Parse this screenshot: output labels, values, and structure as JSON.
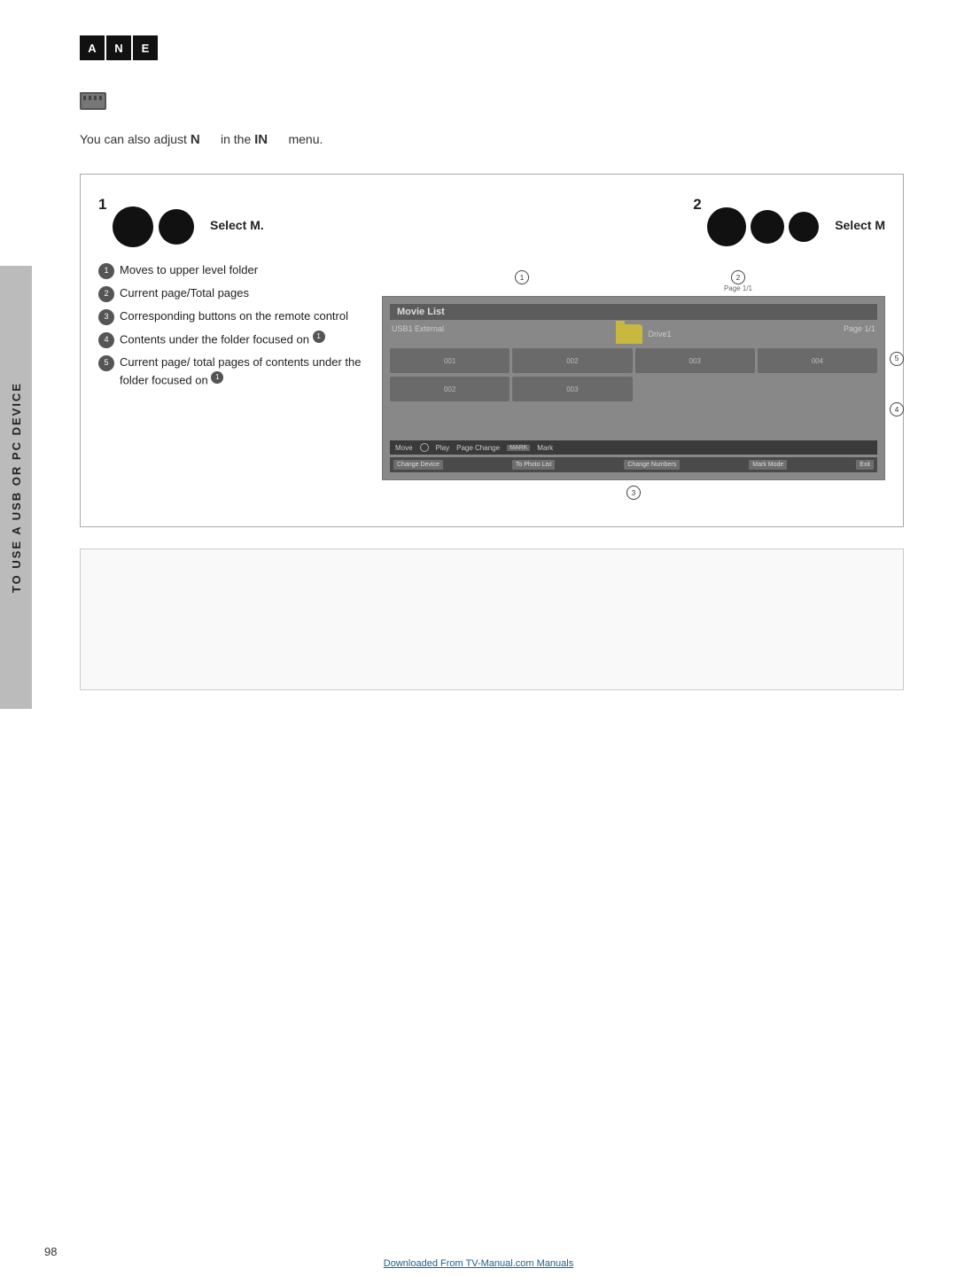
{
  "logo": {
    "blocks": [
      "A",
      "N",
      "E"
    ]
  },
  "sidebar": {
    "text": "TO USE A USB OR PC DEVICE"
  },
  "icon": {
    "alt": "folder with film icon"
  },
  "instruction": {
    "text_before": "You can also adjust",
    "bold1": "N",
    "text_middle": "in the",
    "bold2": "IN",
    "text_after": "menu."
  },
  "diagram": {
    "step1": {
      "number": "1",
      "label": "Select M."
    },
    "step2": {
      "number": "2",
      "label": "Select M"
    },
    "bullets": [
      {
        "num": "1",
        "text": "Moves to upper level folder"
      },
      {
        "num": "2",
        "text": "Current page/Total pages"
      },
      {
        "num": "3",
        "text": "Corresponding buttons on the remote control"
      },
      {
        "num": "4",
        "text": "Contents under the folder focused on",
        "superscript": "1"
      },
      {
        "num": "5",
        "text": "Current page/ total pages of contents under the folder focused on",
        "superscript": "1"
      }
    ],
    "movie_list": {
      "title": "Movie List",
      "usb_label": "USB1 External",
      "drive_label": "Drive1",
      "page_label": "Page 1/1",
      "page_label2": "Page 1/1",
      "files_row1": [
        "001",
        "002",
        "003",
        "004"
      ],
      "files_row2": [
        "002",
        "003"
      ],
      "move_label": "Move",
      "play_label": "Play",
      "page_change_label": "Page Change",
      "mark_label": "Mark",
      "buttons": [
        "Change Device",
        "To Photo List",
        "Change Numbers",
        "Mark Mode",
        "Exit"
      ]
    }
  },
  "page_number": "98",
  "bottom_link": "Downloaded From TV-Manual.com Manuals"
}
